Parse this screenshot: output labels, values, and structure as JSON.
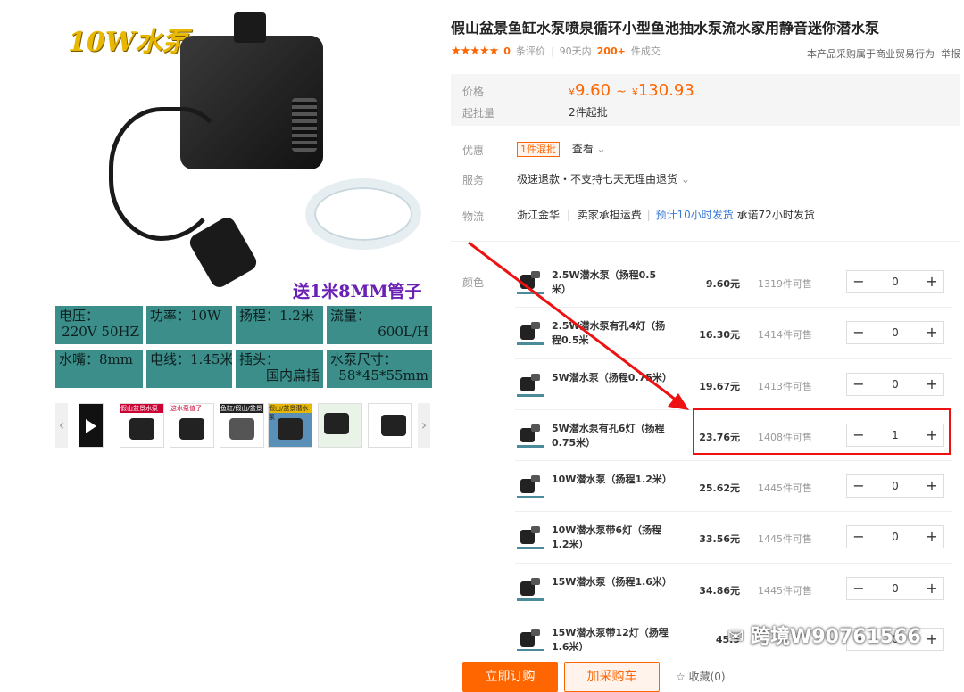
{
  "gallery": {
    "title_art": "10W水泵",
    "gift_note": "送1米8MM管子",
    "specs": [
      {
        "k": "电压：",
        "v": "220V 50HZ"
      },
      {
        "k": "功率：10W",
        "v": ""
      },
      {
        "k": "扬程：1.2米",
        "v": ""
      },
      {
        "k": "流量：",
        "v": "600L/H"
      },
      {
        "k": "水嘴：8mm",
        "v": ""
      },
      {
        "k": "电线：1.45米",
        "v": ""
      },
      {
        "k": "插头：",
        "v": "国内扁插"
      },
      {
        "k": "水泵尺寸：",
        "v": "58*45*55mm"
      }
    ],
    "thumb_labels": [
      "假山盆景水泵",
      "这水泵值了",
      "鱼缸/假山/盆景",
      "假山/盆景潜水泵"
    ]
  },
  "product": {
    "title": "假山盆景鱼缸水泵喷泉循环小型鱼池抽水泵流水家用静音迷你潜水泵",
    "stars": "★★★★★",
    "review_count": "0",
    "review_label": "条评价",
    "period": "90天内",
    "deal_count": "200+",
    "deal_label": "件成交",
    "trade_note": "本产品采购属于商业贸易行为",
    "report": "举报"
  },
  "pricing": {
    "price_label": "价格",
    "currency": "¥",
    "price_low": "9.60",
    "price_tilde": "~",
    "price_high": "130.93",
    "moq_label": "起批量",
    "moq": "2件起批"
  },
  "info": {
    "promo_label": "优惠",
    "promo_tag": "1件混批",
    "promo_view": "查看",
    "service_label": "服务",
    "service": "极速退款・不支持七天无理由退货",
    "logistics_label": "物流",
    "origin": "浙江金华",
    "freight": "卖家承担运费",
    "ship_time": "预计10小时发货",
    "promise": "承诺72小时发货"
  },
  "sku": {
    "color_label": "颜色",
    "items": [
      {
        "name": "2.5W潜水泵（扬程0.5米）",
        "price": "9.60元",
        "stock": "1319件可售",
        "qty": "0"
      },
      {
        "name": "2.5W潜水泵有孔4灯（扬程0.5米",
        "price": "16.30元",
        "stock": "1414件可售",
        "qty": "0"
      },
      {
        "name": "5W潜水泵（扬程0.75米）",
        "price": "19.67元",
        "stock": "1413件可售",
        "qty": "0"
      },
      {
        "name": "5W潜水泵有孔6灯（扬程0.75米）",
        "price": "23.76元",
        "stock": "1408件可售",
        "qty": "1"
      },
      {
        "name": "10W潜水泵（扬程1.2米）",
        "price": "25.62元",
        "stock": "1445件可售",
        "qty": "0"
      },
      {
        "name": "10W潜水泵带6灯（扬程1.2米）",
        "price": "33.56元",
        "stock": "1445件可售",
        "qty": "0"
      },
      {
        "name": "15W潜水泵（扬程1.6米）",
        "price": "34.86元",
        "stock": "1445件可售",
        "qty": "0"
      },
      {
        "name": "15W潜水泵带12灯（扬程1.6米）",
        "price": "45.5",
        "stock": "",
        "qty": "0"
      }
    ],
    "minus": "−",
    "plus": "+"
  },
  "actions": {
    "buy": "立即订购",
    "cart": "加采购车",
    "favorite": "☆ 收藏(0)"
  },
  "watermark": "跨境W90761566",
  "colors": {
    "accent": "#ff6600",
    "highlight": "#e11111",
    "spec_bg": "#3c8e8a"
  }
}
